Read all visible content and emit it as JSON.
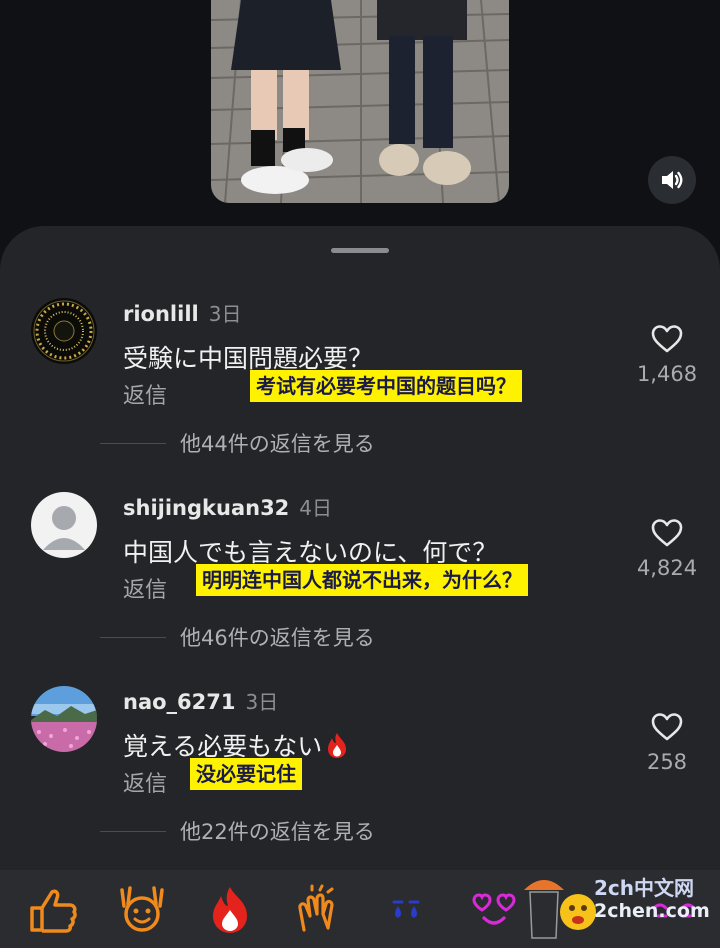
{
  "comments": [
    {
      "username": "rionlill",
      "time": "3日",
      "text": "受験に中国問題必要？",
      "reply_label": "返信",
      "translation": "考试有必要考中国的题目吗？",
      "likes": "1,468",
      "more_replies": "他44件の返信を見る"
    },
    {
      "username": "shijingkuan32",
      "time": "4日",
      "text": "中国人でも言えないのに、何で？",
      "reply_label": "返信",
      "translation": "明明连中国人都说不出来，为什么？",
      "likes": "4,824",
      "more_replies": "他46件の返信を見る"
    },
    {
      "username": "nao_6271",
      "time": "3日",
      "text": "覚える必要もない",
      "reply_label": "返信",
      "translation": "没必要记住",
      "likes": "258",
      "more_replies": "他22件の返信を見る"
    }
  ],
  "watermark": {
    "line1": "2ch中文网",
    "line2": "2chen.com"
  },
  "icons": {
    "sound": "speaker-icon",
    "like": "heart-outline-icon",
    "emojis": [
      "thumbs-up-emoji",
      "face-hands-up-emoji",
      "fire-emoji",
      "clapping-hands-emoji",
      "crying-face-emoji",
      "heart-eyes-emoji",
      "blushing-face-emoji"
    ]
  },
  "colors": {
    "sheet_bg": "#232528",
    "translation_bg": "#fff200",
    "emoji_orange": "#f08a1c",
    "emoji_red": "#e5231d",
    "emoji_magenta": "#d92ad9"
  }
}
